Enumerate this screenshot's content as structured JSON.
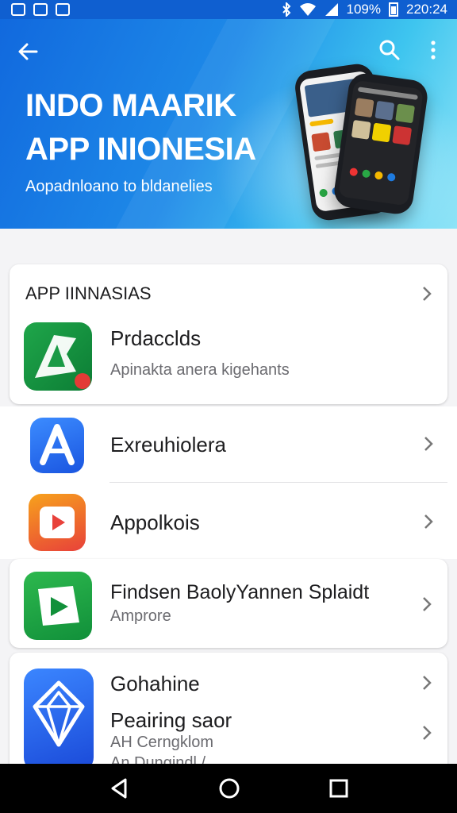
{
  "status_bar": {
    "battery": "109%",
    "time": "220:24"
  },
  "hero": {
    "title_line1": "INDO MAARIK",
    "title_line2": "APP INIONESIA",
    "subtitle": "Aopadnloano to bldanelies"
  },
  "section": {
    "header": "APP IINNASIAS"
  },
  "apps": [
    {
      "title": "Prdacclds",
      "subtitle": "Apinakta anera kigehants"
    },
    {
      "title": "Exreuhiolera"
    },
    {
      "title": "Appolkois"
    },
    {
      "title": "Findsen BaolyYannen Splaidt",
      "subtitle": "Amprore"
    },
    {
      "title": "Gohahine",
      "title2": "Peairing saor",
      "subtitle": "AH Cerngklom",
      "subtitle2": "An Dungindl /"
    }
  ],
  "colors": {
    "brand": "#1169de",
    "accent": "#3ec5ef",
    "nav": "#000000"
  }
}
